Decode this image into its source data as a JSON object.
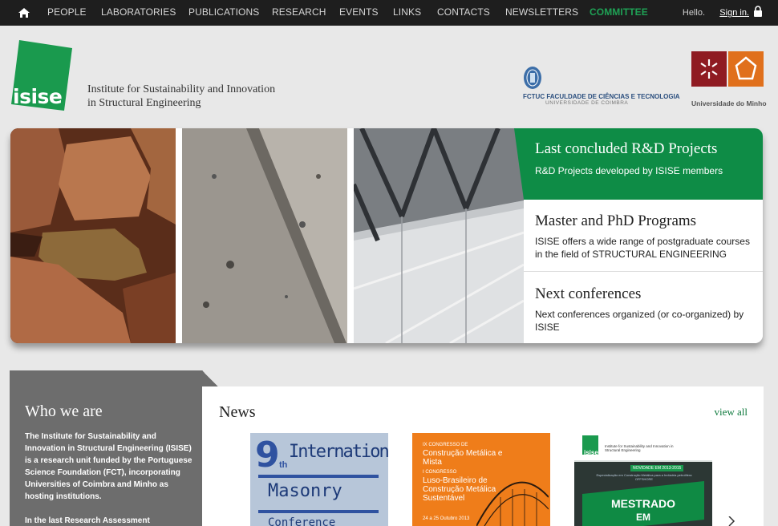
{
  "nav": {
    "items": [
      {
        "label": "PEOPLE",
        "active": false
      },
      {
        "label": "LABORATORIES",
        "active": false
      },
      {
        "label": "PUBLICATIONS",
        "active": false
      },
      {
        "label": "RESEARCH",
        "active": false
      },
      {
        "label": "EVENTS",
        "active": false
      },
      {
        "label": "LINKS",
        "active": false
      },
      {
        "label": "CONTACTS",
        "active": false
      },
      {
        "label": "NEWSLETTERS",
        "active": false
      },
      {
        "label": "COMMITTEE",
        "active": true
      }
    ],
    "hello": "Hello.",
    "signin": "Sign in."
  },
  "header": {
    "logo": "isise",
    "tagline_line1": "Institute for Sustainability and Innovation",
    "tagline_line2": "in Structural Engineering",
    "partner1_name": "FCTUC FACULDADE DE CIÊNCIAS E TECNOLOGIA",
    "partner1_sub": "UNIVERSIDADE DE COIMBRA",
    "partner2_name": "Universidade do Minho"
  },
  "colors": {
    "brand_green": "#0e8c46",
    "nav_bg": "#1e1e1e",
    "who_bg": "#6d6d6d"
  },
  "slider": {
    "panels": [
      {
        "title": "Last concluded R&D Projects",
        "body": "R&D Projects developed by ISISE members"
      },
      {
        "title": "Master and PhD Programs",
        "body": "ISISE offers a wide range of postgraduate courses in the field of STRUCTURAL ENGINEERING"
      },
      {
        "title": "Next conferences",
        "body": "Next conferences organized (or co-organized) by ISISE"
      }
    ]
  },
  "who": {
    "title": "Who we are",
    "p1": "The Institute for Sustainability and Innovation in Structural Engineering (ISISE) is a research unit funded by the Portuguese Science Foundation (FCT), incorporating Universities of Coimbra and Minho as hosting institutions.",
    "p2": "In the last Research Assessment"
  },
  "news": {
    "title": "News",
    "view_all": "view all",
    "card1": {
      "big": "9",
      "sup": "th",
      "line1": "International",
      "line2": "Masonry",
      "line3": "Conference"
    },
    "card2": {
      "a": "IX CONGRESSO DE",
      "b": "Construção Metálica e Mista",
      "c": "I CONGRESSO",
      "d": "Luso-Brasileiro de Construção Metálica Sustentável",
      "e": "24 a 25 Outubro 2013"
    },
    "card3": {
      "logo": "isise",
      "inst": "Institute for Sustainability and Innovation in Structural Engineering",
      "novidade": "NOVIDADE EM 2013-2015",
      "small": "Especialização em Construção Metálica para a Indústria petrolífera OFFSHORE",
      "title": "MESTRADO",
      "title2": "EM"
    }
  }
}
